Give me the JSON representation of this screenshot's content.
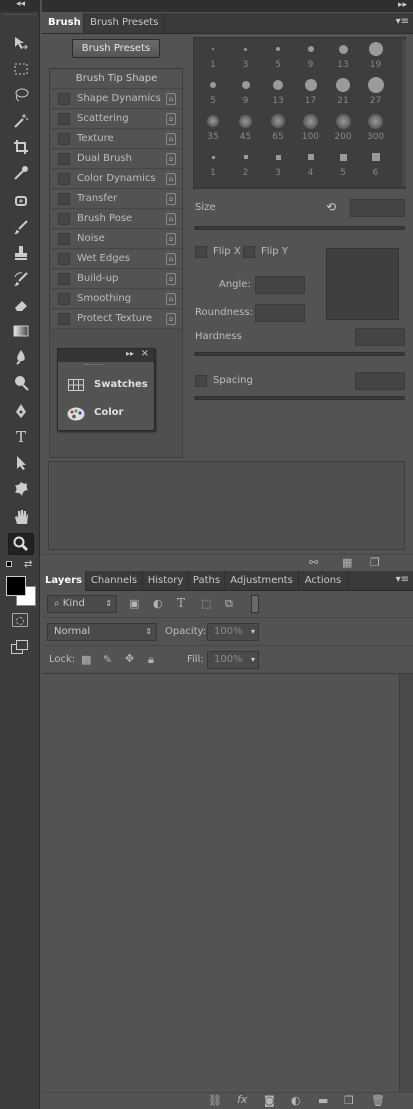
{
  "toolbar": {
    "tools": [
      "move-tool",
      "marquee-tool",
      "lasso-tool",
      "magic-wand-tool",
      "crop-tool",
      "eyedropper-tool",
      "healing-brush-tool",
      "brush-tool",
      "clone-stamp-tool",
      "history-brush-tool",
      "eraser-tool",
      "gradient-tool",
      "blur-tool",
      "dodge-tool",
      "pen-tool",
      "type-tool",
      "path-selection-tool",
      "shape-tool",
      "hand-tool",
      "zoom-tool"
    ],
    "type_glyph": "T"
  },
  "brush_panel": {
    "tabs": [
      "Brush",
      "Brush Presets"
    ],
    "presets_button": "Brush Presets",
    "options": [
      "Brush Tip Shape",
      "Shape Dynamics",
      "Scattering",
      "Texture",
      "Dual Brush",
      "Color Dynamics",
      "Transfer",
      "Brush Pose",
      "Noise",
      "Wet Edges",
      "Build-up",
      "Smoothing",
      "Protect Texture"
    ],
    "tip_sizes": [
      "1",
      "3",
      "5",
      "9",
      "13",
      "19",
      "5",
      "9",
      "13",
      "17",
      "21",
      "27",
      "35",
      "45",
      "65",
      "100",
      "200",
      "300",
      "1",
      "2",
      "3",
      "4",
      "5",
      "6"
    ],
    "size_label": "Size",
    "flip_x": "Flip X",
    "flip_y": "Flip Y",
    "angle_label": "Angle:",
    "roundness_label": "Roundness:",
    "hardness_label": "Hardness",
    "spacing_label": "Spacing"
  },
  "floating_panel": {
    "items": [
      "Swatches",
      "Color"
    ]
  },
  "layers_panel": {
    "tabs": [
      "Layers",
      "Channels",
      "History",
      "Paths",
      "Adjustments",
      "Actions"
    ],
    "kind_label": "Kind",
    "blend_mode": "Normal",
    "opacity_label": "Opacity:",
    "opacity_value": "100%",
    "lock_label": "Lock:",
    "fill_label": "Fill:",
    "fill_value": "100%",
    "footer_icons": [
      "link-icon",
      "fx-icon",
      "mask-icon",
      "adjustment-icon",
      "folder-icon",
      "new-layer-icon",
      "trash-icon"
    ],
    "fx_glyph": "fx"
  }
}
